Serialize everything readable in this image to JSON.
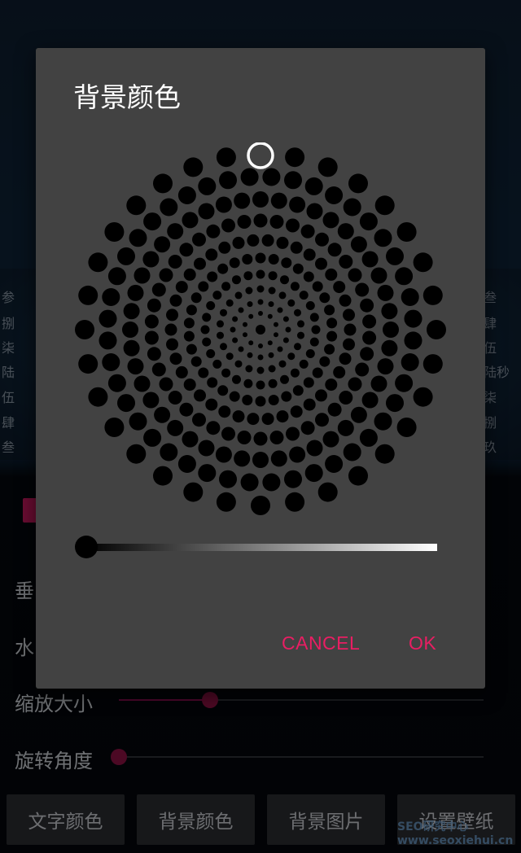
{
  "dialog": {
    "title": "背景颜色",
    "cancel_label": "CANCEL",
    "ok_label": "OK",
    "selected_color": "#000000",
    "lightness": 0
  },
  "settings": {
    "rows": [
      {
        "label": "垂",
        "value": null
      },
      {
        "label": "水",
        "value": null
      },
      {
        "label": "缩放大小",
        "value": 0.25
      },
      {
        "label": "旋转角度",
        "value": 0.0
      }
    ]
  },
  "preview": {
    "left_fragments": [
      "参",
      "捌",
      "柒",
      "陆",
      "伍",
      "肆",
      "叁"
    ],
    "right_fragments": [
      "叁",
      "肆",
      "伍",
      "陆秒",
      "柒",
      "捌",
      "玖"
    ]
  },
  "buttons": {
    "text_color": "文字颜色",
    "background_color": "背景颜色",
    "background_image": "背景图片",
    "set_wallpaper": "设置壁纸"
  },
  "watermark": "SEO研究中心 www.seoxiehui.cn",
  "colors": {
    "accent": "#e91e63",
    "dialog_bg": "#424242",
    "slider_fill": "#880e4f"
  }
}
